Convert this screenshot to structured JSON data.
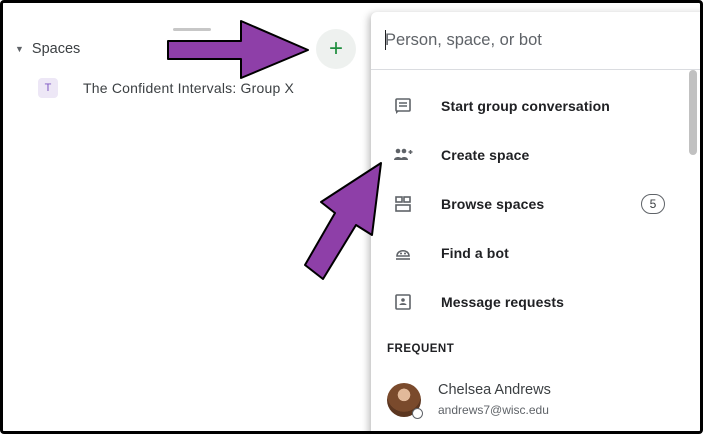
{
  "left_panel": {
    "section_title": "Spaces",
    "add_symbol": "+",
    "spaces": [
      {
        "initial": "T",
        "name": "The Confident Intervals: Group X"
      }
    ]
  },
  "dropdown": {
    "search_placeholder": "Person, space, or bot",
    "menu_items": [
      {
        "label": "Start group conversation",
        "icon": "chat-icon"
      },
      {
        "label": "Create space",
        "icon": "group-add-icon"
      },
      {
        "label": "Browse spaces",
        "icon": "grid-icon",
        "badge": "5"
      },
      {
        "label": "Find a bot",
        "icon": "bot-icon"
      },
      {
        "label": "Message requests",
        "icon": "message-requests-icon"
      }
    ],
    "frequent_heading": "FREQUENT",
    "frequent": [
      {
        "name": "Chelsea Andrews",
        "email": "andrews7@wisc.edu"
      }
    ]
  },
  "colors": {
    "arrow_fill": "#8e3fa8",
    "accent_green": "#1e8e3e",
    "icon_gray": "#5f6368"
  }
}
